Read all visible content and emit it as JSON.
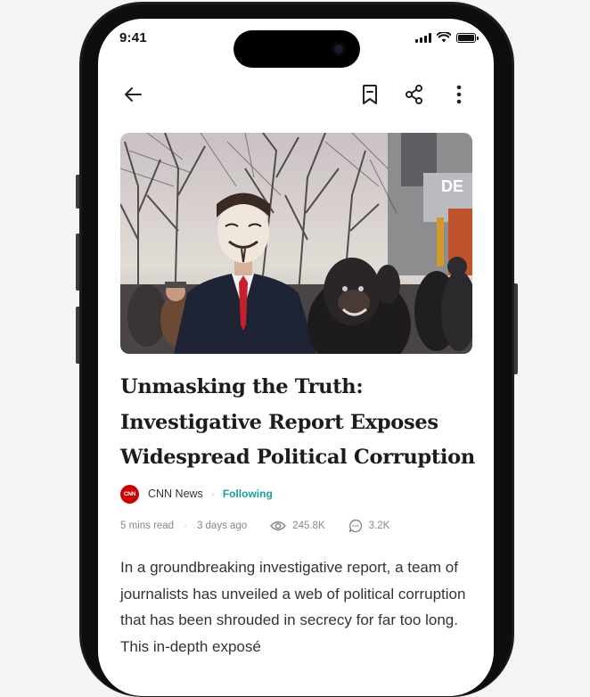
{
  "status_bar": {
    "time": "9:41"
  },
  "toolbar": {
    "back_icon": "arrow-left-icon",
    "bookmark_icon": "bookmark-icon",
    "share_icon": "share-icon",
    "more_icon": "more-vertical-icon"
  },
  "hero_image": {
    "description": "Protest crowd with man in Guy Fawkes mask and person in gorilla mask"
  },
  "article": {
    "headline_lines": [
      "Unmasking the Truth:",
      "Investigative Report Exposes",
      "Widespread Political Corruption"
    ],
    "source": {
      "logo_text": "CNN",
      "name": "CNN News",
      "separator": "·",
      "follow_label": "Following"
    },
    "meta": {
      "read_time": "5 mins read",
      "separator": "·",
      "published": "3 days ago",
      "views": "245.8K",
      "comments": "3.2K"
    },
    "body": "In a groundbreaking investigative report, a team of journalists has unveiled a web of political corruption that has been shrouded in secrecy for far too long. This in-depth exposé"
  },
  "colors": {
    "accent": "#1aa09a",
    "cnn_red": "#cc0000",
    "headline": "#1c1c1e",
    "meta": "#888888"
  }
}
